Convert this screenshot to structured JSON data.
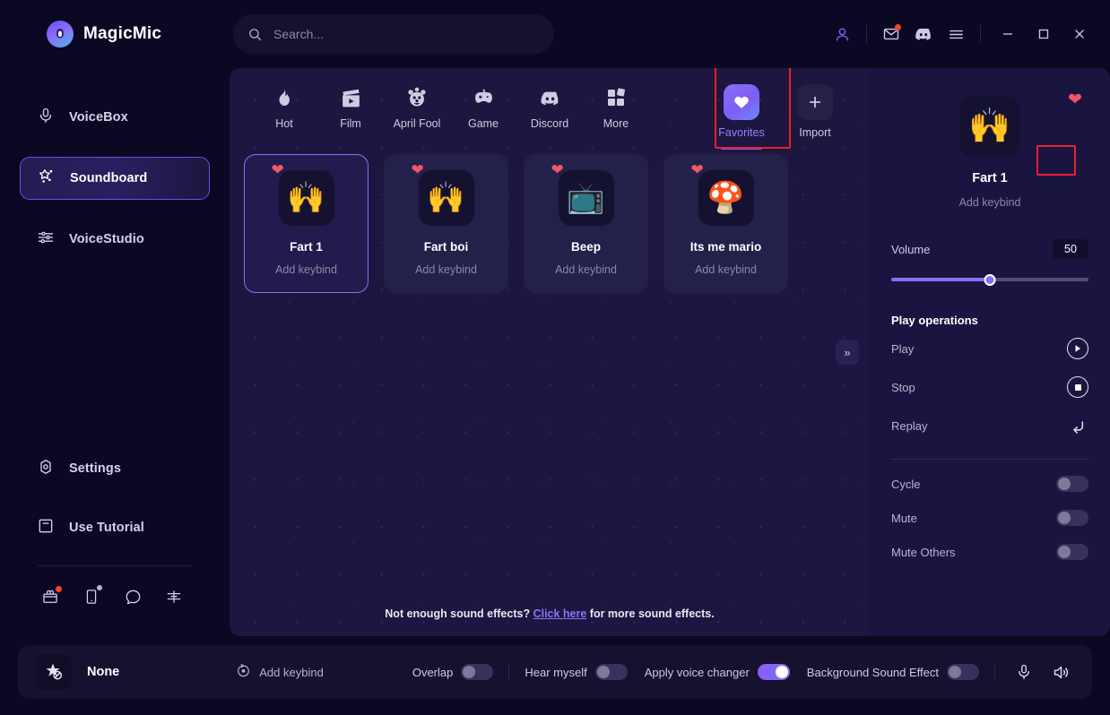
{
  "app": {
    "brand": "MagicMic",
    "brand_logo_icon": "magicmic-logo-icon"
  },
  "search": {
    "placeholder": "Search...",
    "value": "",
    "icon": "search-icon"
  },
  "titlebar": {
    "icons": [
      {
        "name": "account-icon",
        "glyph": "person"
      },
      {
        "name": "mail-icon",
        "glyph": "envelope",
        "badge": true
      },
      {
        "name": "discord-icon",
        "glyph": "discord"
      },
      {
        "name": "menu-icon",
        "glyph": "hamburger"
      }
    ],
    "window_controls": [
      {
        "name": "minimize-button",
        "glyph": "minimize"
      },
      {
        "name": "maximize-button",
        "glyph": "maximize"
      },
      {
        "name": "close-button",
        "glyph": "close"
      }
    ]
  },
  "sidebar": {
    "items": [
      {
        "label": "VoiceBox",
        "icon": "microphone-icon",
        "active": false
      },
      {
        "label": "Soundboard",
        "icon": "magic-star-icon",
        "active": true
      },
      {
        "label": "VoiceStudio",
        "icon": "sliders-icon",
        "active": false
      }
    ],
    "bottom_items": [
      {
        "label": "Settings",
        "icon": "gear-icon"
      },
      {
        "label": "Use Tutorial",
        "icon": "book-icon"
      }
    ],
    "mini_icons": [
      {
        "name": "gift-box-icon",
        "badge": "red"
      },
      {
        "name": "mobile-device-icon",
        "badge": "grey"
      },
      {
        "name": "chat-bubble-icon",
        "badge": "none"
      },
      {
        "name": "feedback-icon",
        "badge": "none"
      }
    ]
  },
  "tabs": [
    {
      "label": "Hot",
      "icon": "flame-icon",
      "active": false
    },
    {
      "label": "Film",
      "icon": "clapperboard-icon",
      "active": false
    },
    {
      "label": "April Fool",
      "icon": "clown-face-icon",
      "active": false
    },
    {
      "label": "Game",
      "icon": "gamepad-icon",
      "active": false
    },
    {
      "label": "Discord",
      "icon": "discord-icon",
      "active": false
    },
    {
      "label": "More",
      "icon": "grid-squares-icon",
      "active": false
    },
    {
      "label": "Favorites",
      "icon": "heart-icon",
      "active": true
    },
    {
      "label": "Import",
      "icon": "plus-icon",
      "active": false
    }
  ],
  "sounds": [
    {
      "name": "Fart 1",
      "keybind": "Add keybind",
      "emoji": "🙌",
      "favorited": true,
      "selected": true
    },
    {
      "name": "Fart boi",
      "keybind": "Add keybind",
      "emoji": "🙌",
      "favorited": true,
      "selected": false
    },
    {
      "name": "Beep",
      "keybind": "Add keybind",
      "emoji": "📺",
      "favorited": true,
      "selected": false
    },
    {
      "name": "Its me mario",
      "keybind": "Add keybind",
      "emoji": "🍄",
      "favorited": true,
      "selected": false
    }
  ],
  "collapse_button": {
    "glyph": "»",
    "name": "expand-panel-button"
  },
  "footer": {
    "text_before": "Not enough sound effects? ",
    "link_text": "Click here",
    "text_after": " for more sound effects."
  },
  "details": {
    "favorite_icon": "heart-filled-icon",
    "title": "Fart 1",
    "keybind": "Add keybind",
    "emoji": "🙌",
    "volume_label": "Volume",
    "volume_value": "50",
    "volume_percent": 50,
    "play_section_title": "Play operations",
    "operations": [
      {
        "label": "Play",
        "icon": "play-icon"
      },
      {
        "label": "Stop",
        "icon": "stop-icon"
      },
      {
        "label": "Replay",
        "icon": "replay-icon"
      }
    ],
    "toggles": [
      {
        "label": "Cycle",
        "on": false
      },
      {
        "label": "Mute",
        "on": false
      },
      {
        "label": "Mute Others",
        "on": false
      }
    ]
  },
  "bottombar": {
    "voice_name": "None",
    "voice_icon": "star-disabled-icon",
    "add_keybind": "Add keybind",
    "add_keybind_icon": "keybind-record-icon",
    "toggles": [
      {
        "label": "Overlap",
        "on": false
      },
      {
        "label": "Hear myself",
        "on": false
      },
      {
        "label": "Apply voice changer",
        "on": true
      },
      {
        "label": "Background Sound Effect",
        "on": false
      }
    ],
    "icons": [
      {
        "name": "microphone-icon"
      },
      {
        "name": "speaker-icon"
      }
    ]
  },
  "colors": {
    "accent": "#7e5df5",
    "heart": "#f2566b",
    "highlight_box": "#ef1f29",
    "panel_bg": "#1c1640",
    "sidebar_bg": "#0b0824"
  }
}
